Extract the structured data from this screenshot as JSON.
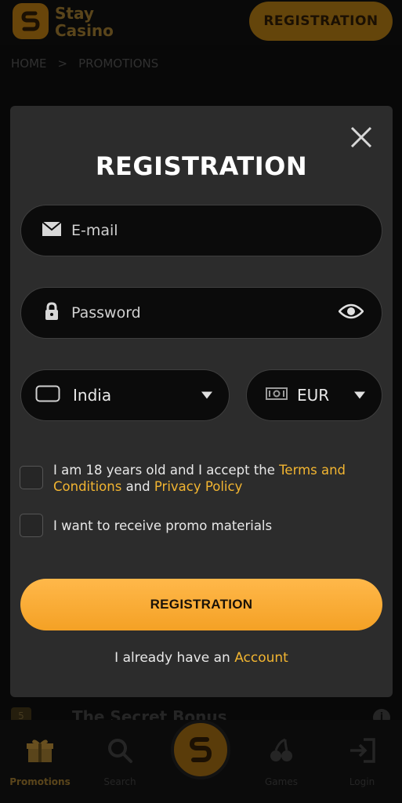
{
  "header": {
    "logo_line1": "Stay",
    "logo_line2": "Casino",
    "registration_label": "REGISTRATION"
  },
  "breadcrumb": {
    "home": "HOME",
    "separator": ">",
    "current": "PROMOTIONS"
  },
  "background": {
    "badge": "5",
    "card_title": "The Secret Bonus",
    "info": "i"
  },
  "modal": {
    "title": "REGISTRATION",
    "email_placeholder": "E-mail",
    "password_placeholder": "Password",
    "country_value": "India",
    "currency_value": "EUR",
    "terms_prefix": "I am 18 years old and I accept the ",
    "terms_link": "Terms and Conditions",
    "terms_and": " and ",
    "privacy_link": "Privacy Policy",
    "promo_label": "I want to receive promo materials",
    "submit_label": "REGISTRATION",
    "account_prefix": "I already have an ",
    "account_link": "Account",
    "icons": {
      "close": "close-icon",
      "email": "envelope-icon",
      "password": "lock-icon",
      "visibility": "eye-icon",
      "country": "flag-icon",
      "currency": "banknote-icon"
    }
  },
  "bottom_nav": {
    "items": [
      {
        "label": "Promotions",
        "icon": "gift-icon",
        "active": true
      },
      {
        "label": "Search",
        "icon": "search-icon"
      },
      {
        "label": "",
        "icon": "logo-s-icon"
      },
      {
        "label": "Games",
        "icon": "cherries-icon"
      },
      {
        "label": "Login",
        "icon": "login-icon"
      }
    ]
  },
  "colors": {
    "accent": "#f2b531",
    "button_gradient_top": "#ffb84a",
    "button_gradient_bottom": "#f4a125",
    "modal_bg": "#2c2c2c",
    "field_bg": "#0b0b0b"
  }
}
